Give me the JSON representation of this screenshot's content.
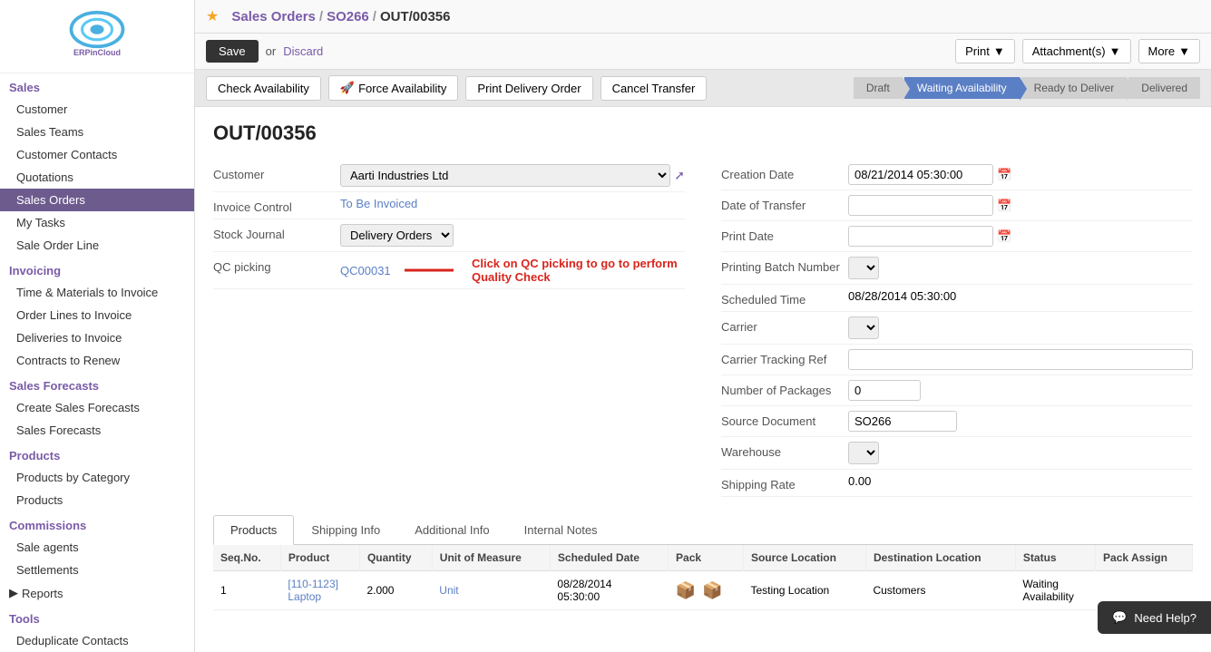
{
  "sidebar": {
    "logo_text": "ERPinCloud",
    "sections": [
      {
        "label": "Sales",
        "items": [
          {
            "label": "Customer",
            "active": false
          },
          {
            "label": "Sales Teams",
            "active": false
          },
          {
            "label": "Customer Contacts",
            "active": false
          },
          {
            "label": "Quotations",
            "active": false
          },
          {
            "label": "Sales Orders",
            "active": true
          },
          {
            "label": "My Tasks",
            "active": false
          },
          {
            "label": "Sale Order Line",
            "active": false
          }
        ]
      },
      {
        "label": "Invoicing",
        "items": [
          {
            "label": "Time & Materials to Invoice",
            "active": false
          },
          {
            "label": "Order Lines to Invoice",
            "active": false
          },
          {
            "label": "Deliveries to Invoice",
            "active": false
          },
          {
            "label": "Contracts to Renew",
            "active": false
          }
        ]
      },
      {
        "label": "Sales Forecasts",
        "items": [
          {
            "label": "Create Sales Forecasts",
            "active": false
          },
          {
            "label": "Sales Forecasts",
            "active": false
          }
        ]
      },
      {
        "label": "Products",
        "items": [
          {
            "label": "Products by Category",
            "active": false
          },
          {
            "label": "Products",
            "active": false
          }
        ]
      },
      {
        "label": "Commissions",
        "items": [
          {
            "label": "Sale agents",
            "active": false
          },
          {
            "label": "Settlements",
            "active": false
          }
        ]
      },
      {
        "label": "Reports",
        "items": [],
        "toggle": true
      },
      {
        "label": "Tools",
        "items": [
          {
            "label": "Deduplicate Contacts",
            "active": false
          }
        ]
      }
    ]
  },
  "breadcrumb": {
    "parts": [
      "Sales Orders",
      "SO266",
      "OUT/00356"
    ],
    "star": true
  },
  "toolbar": {
    "save_label": "Save",
    "or_label": "or",
    "discard_label": "Discard",
    "print_label": "Print",
    "attachments_label": "Attachment(s)",
    "more_label": "More"
  },
  "workflow": {
    "check_availability_label": "Check Availability",
    "force_availability_label": "Force Availability",
    "print_delivery_label": "Print Delivery Order",
    "cancel_transfer_label": "Cancel Transfer",
    "steps": [
      {
        "label": "Draft",
        "active": false
      },
      {
        "label": "Waiting Availability",
        "active": true
      },
      {
        "label": "Ready to Deliver",
        "active": false
      },
      {
        "label": "Delivered",
        "active": false
      }
    ]
  },
  "form": {
    "title": "OUT/00356",
    "left": {
      "customer_label": "Customer",
      "customer_value": "Aarti Industries Ltd",
      "invoice_control_label": "Invoice Control",
      "invoice_control_value": "To Be Invoiced",
      "stock_journal_label": "Stock Journal",
      "stock_journal_value": "Delivery Orders",
      "qc_picking_label": "QC picking",
      "qc_picking_value": "QC00031",
      "qc_annotation": "Click on QC picking to go to perform Quality Check"
    },
    "right": {
      "creation_date_label": "Creation Date",
      "creation_date_value": "08/21/2014 05:30:00",
      "date_of_transfer_label": "Date of Transfer",
      "date_of_transfer_value": "",
      "print_date_label": "Print Date",
      "print_date_value": "",
      "printing_batch_label": "Printing Batch Number",
      "printing_batch_value": "",
      "scheduled_time_label": "Scheduled Time",
      "scheduled_time_value": "08/28/2014 05:30:00",
      "carrier_label": "Carrier",
      "carrier_value": "",
      "carrier_tracking_label": "Carrier Tracking Ref",
      "carrier_tracking_value": "",
      "num_packages_label": "Number of Packages",
      "num_packages_value": "0",
      "source_document_label": "Source Document",
      "source_document_value": "SO266",
      "warehouse_label": "Warehouse",
      "warehouse_value": "",
      "shipping_rate_label": "Shipping Rate",
      "shipping_rate_value": "0.00"
    }
  },
  "tabs": [
    {
      "label": "Products",
      "active": true
    },
    {
      "label": "Shipping Info",
      "active": false
    },
    {
      "label": "Additional Info",
      "active": false
    },
    {
      "label": "Internal Notes",
      "active": false
    }
  ],
  "table": {
    "columns": [
      "Seq.No.",
      "Product",
      "Quantity",
      "Unit of Measure",
      "Scheduled Date",
      "Pack",
      "Source Location",
      "Destination Location",
      "Status",
      "Pack Assign"
    ],
    "rows": [
      {
        "seq": "1",
        "product": "[110-1123]\nLaptop",
        "quantity": "2.000",
        "unit": "Unit",
        "scheduled_date": "08/28/2014\n05:30:00",
        "pack": "",
        "source_location": "Testing Location",
        "destination_location": "Customers",
        "status": "Waiting\nAvailability",
        "pack_assign": ""
      }
    ]
  },
  "need_help": {
    "label": "Need Help?"
  }
}
